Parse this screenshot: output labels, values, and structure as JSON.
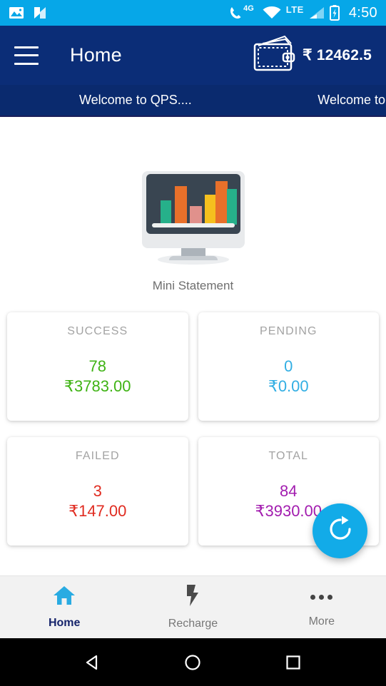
{
  "status_bar": {
    "background": "#06A7E8",
    "icons": [
      "image-icon",
      "nougat-n-icon",
      "phone-4g-icon",
      "wifi-icon",
      "signal-icon",
      "battery-charging-icon"
    ],
    "network_4g": "4G",
    "network_lte": "LTE",
    "time": "4:50"
  },
  "app_bar": {
    "background": "#0B2D77",
    "menu_icon": "hamburger-menu-icon",
    "title": "Home",
    "wallet_icon": "wallet-icon",
    "wallet_balance": "₹ 12462.5"
  },
  "banner": {
    "background": "#0A2A6E",
    "text_primary": "Welcome to QPS....",
    "text_secondary": "Welcome to"
  },
  "hero": {
    "icon": "monitor-bar-chart-icon",
    "label": "Mini Statement",
    "screen_color": "#394551",
    "bar_colors": [
      "#26B08A",
      "#E8702A",
      "#E0918C",
      "#F5C01E",
      "#E8702A",
      "#26B08A"
    ]
  },
  "stats": [
    {
      "title": "SUCCESS",
      "count": "78",
      "amount": "₹3783.00",
      "color": "#3FB314"
    },
    {
      "title": "PENDING",
      "count": "0",
      "amount": "₹0.00",
      "color": "#31AEE3"
    },
    {
      "title": "FAILED",
      "count": "3",
      "amount": "₹147.00",
      "color": "#E02B20"
    },
    {
      "title": "TOTAL",
      "count": "84",
      "amount": "₹3930.00",
      "color": "#A21CAF"
    }
  ],
  "fab": {
    "icon": "refresh-icon",
    "color": "#12ABE8"
  },
  "bottom_nav": {
    "background": "#F2F2F2",
    "items": [
      {
        "label": "Home",
        "icon": "home-icon",
        "active": true
      },
      {
        "label": "Recharge",
        "icon": "lightning-bolt-icon",
        "active": false
      },
      {
        "label": "More",
        "icon": "more-dots-icon",
        "active": false
      }
    ]
  },
  "system_nav": {
    "background": "#000000",
    "buttons": [
      "back-triangle-icon",
      "home-circle-icon",
      "recents-square-icon"
    ]
  }
}
